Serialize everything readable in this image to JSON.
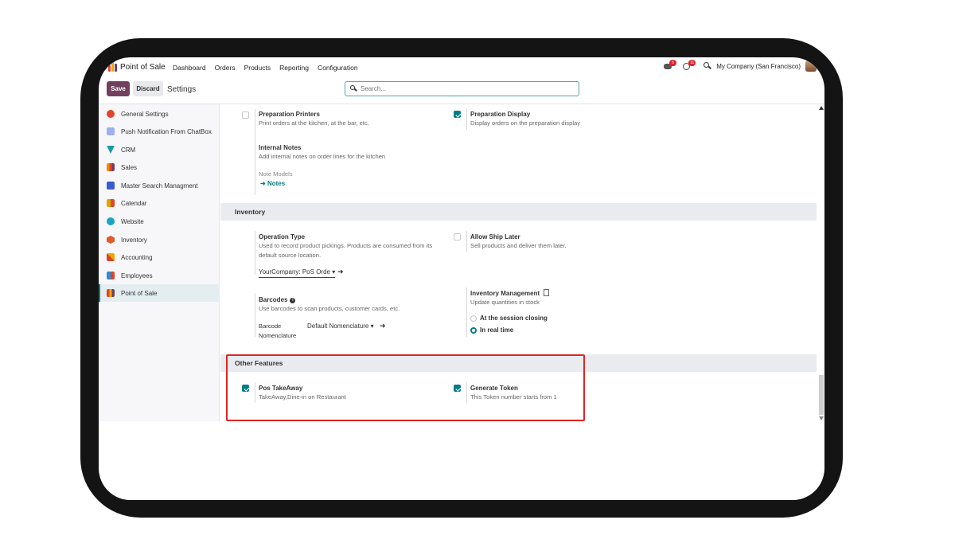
{
  "topnav": {
    "app_name": "Point of Sale",
    "menu": [
      "Dashboard",
      "Orders",
      "Products",
      "Reporting",
      "Configuration"
    ],
    "messages_badge": "5",
    "activity_badge": "11",
    "company": "My Company (San Francisco)"
  },
  "control_panel": {
    "save_label": "Save",
    "discard_label": "Discard",
    "title": "Settings",
    "search_placeholder": "Search..."
  },
  "sidebar": {
    "items": [
      {
        "label": "General Settings",
        "icon": "general-settings-icon",
        "color": "#e0452b"
      },
      {
        "label": "Push Notification From ChatBox",
        "icon": "chatbox-icon",
        "color": "#7f8fe0"
      },
      {
        "label": "CRM",
        "icon": "crm-icon",
        "color": "#1b9ba3"
      },
      {
        "label": "Sales",
        "icon": "sales-icon",
        "color": "#f08c00"
      },
      {
        "label": "Master Search Managment",
        "icon": "master-search-icon",
        "color": "#3a5ad1"
      },
      {
        "label": "Calendar",
        "icon": "calendar-icon",
        "color": "#e0a300"
      },
      {
        "label": "Website",
        "icon": "website-icon",
        "color": "#1ba3c6"
      },
      {
        "label": "Inventory",
        "icon": "inventory-icon",
        "color": "#e05a2b"
      },
      {
        "label": "Accounting",
        "icon": "accounting-icon",
        "color": "#d9462b"
      },
      {
        "label": "Employees",
        "icon": "employees-icon",
        "color": "#2b8fd9"
      },
      {
        "label": "Point of Sale",
        "icon": "point-of-sale-icon",
        "color": "#f0a500"
      }
    ],
    "active_index": 10
  },
  "content": {
    "preparation_printers": {
      "label": "Preparation Printers",
      "desc": "Print orders at the kitchen, at the bar, etc.",
      "checked": false
    },
    "preparation_display": {
      "label": "Preparation Display",
      "desc": "Display orders on the preparation display",
      "checked": true
    },
    "internal_notes": {
      "label": "Internal Notes",
      "desc": "Add internal notes on order lines for the kitchen",
      "note_models_label": "Note Models",
      "notes_link": "Notes"
    },
    "inventory": {
      "heading": "Inventory",
      "operation_type": {
        "label": "Operation Type",
        "desc": "Used to record product pickings. Products are consumed from its default source location.",
        "value": "YourCompany: PoS Orde"
      },
      "allow_ship_later": {
        "label": "Allow Ship Later",
        "desc": "Sell products and deliver them later.",
        "checked": false
      },
      "barcodes": {
        "label": "Barcodes",
        "desc": "Use barcodes to scan products, customer cards, etc.",
        "nomenclature_label_1": "Barcode",
        "nomenclature_label_2": "Nomenclature",
        "nomenclature_value": "Default Nomenclature"
      },
      "inventory_management": {
        "label": "Inventory Management",
        "desc": "Update quantities in stock",
        "options": [
          "At the session closing",
          "In real time"
        ],
        "selected": 1
      }
    },
    "other_features": {
      "heading": "Other Features",
      "pos_takeaway": {
        "label": "Pos TakeAway",
        "desc": "TakeAway,Dine-in on Restaurant",
        "checked": true
      },
      "generate_token": {
        "label": "Generate Token",
        "desc": "This Token number starts from 1",
        "checked": true
      }
    }
  },
  "colors": {
    "primary": "#71405f",
    "accent": "#017e84",
    "highlight": "#e02424"
  }
}
